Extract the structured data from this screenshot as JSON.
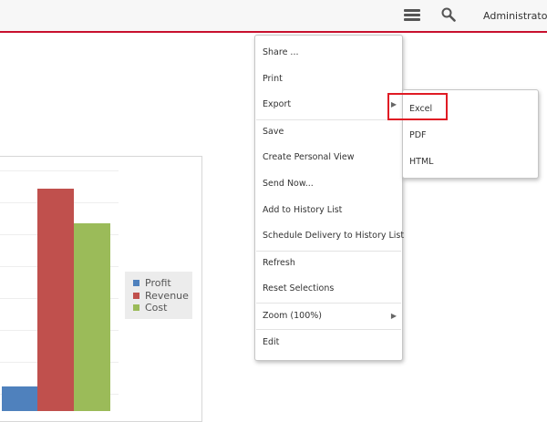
{
  "header": {
    "user_label": "Administrator",
    "accent_color": "#c8102e",
    "icons": [
      "hamburger-menu-icon",
      "search-icon",
      "caret-down-icon"
    ]
  },
  "chart_data": {
    "type": "bar",
    "series": [
      {
        "name": "Profit",
        "color": "#4f81bd"
      },
      {
        "name": "Revenue",
        "color": "#c0504d"
      },
      {
        "name": "Cost",
        "color": "#9bbb59"
      }
    ],
    "legend_placement": "right",
    "grid": true
  },
  "menu": {
    "items": [
      {
        "label": "Share ..."
      },
      {
        "label": "Print"
      },
      {
        "label": "Export",
        "submenu": true
      },
      {
        "label": "Save"
      },
      {
        "label": "Create Personal View"
      },
      {
        "label": "Send Now..."
      },
      {
        "label": "Add to History List"
      },
      {
        "label": "Schedule Delivery to History List"
      },
      {
        "label": "Refresh"
      },
      {
        "label": "Reset Selections"
      },
      {
        "label": "Zoom (100%)",
        "submenu": true
      },
      {
        "label": "Edit"
      }
    ]
  },
  "export_submenu": {
    "items": [
      {
        "label": "Excel"
      },
      {
        "label": "PDF"
      },
      {
        "label": "HTML"
      }
    ],
    "highlight_color": "#e01b24"
  }
}
